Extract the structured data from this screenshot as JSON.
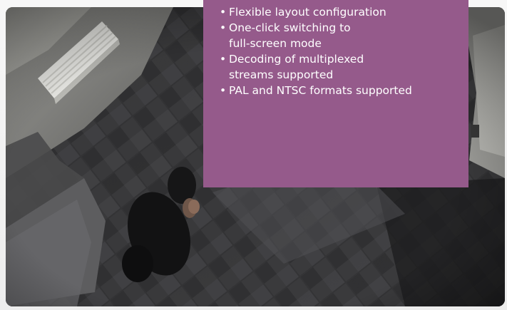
{
  "overlay": {
    "background_color": "#955a8b",
    "text_color": "#ffffff",
    "features": [
      {
        "lines": [
          "Flexible layout configuration"
        ]
      },
      {
        "lines": [
          "One-click switching to",
          "full-screen mode"
        ]
      },
      {
        "lines": [
          "Decoding of multiplexed",
          "streams supported"
        ]
      },
      {
        "lines": [
          "PAL and NTSC formats supported"
        ]
      }
    ]
  },
  "video": {
    "description_icon": "surveillance-camera-view"
  }
}
